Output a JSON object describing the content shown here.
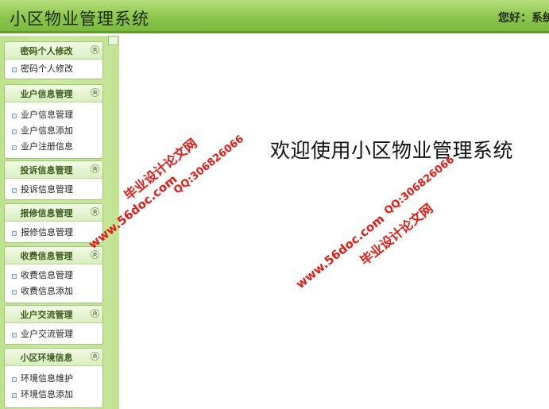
{
  "header": {
    "title": "小区物业管理系统",
    "greeting_prefix": "您好：",
    "greeting_user": "系统"
  },
  "sidebar": {
    "groups": [
      {
        "title": "密码个人修改",
        "items": [
          "密码个人修改"
        ]
      },
      {
        "title": "业户信息管理",
        "items": [
          "业户信息管理",
          "业户信息添加",
          "业户注册信息"
        ]
      },
      {
        "title": "投诉信息管理",
        "items": [
          "投诉信息管理"
        ]
      },
      {
        "title": "报修信息管理",
        "items": [
          "报修信息管理"
        ]
      },
      {
        "title": "收费信息管理",
        "items": [
          "收费信息管理",
          "收费信息添加"
        ]
      },
      {
        "title": "业户交流管理",
        "items": [
          "业户交流管理"
        ]
      },
      {
        "title": "小区环境信息",
        "items": [
          "环境信息维护",
          "环境信息添加"
        ]
      }
    ]
  },
  "main": {
    "welcome": "欢迎使用小区物业管理系统"
  },
  "watermarks": {
    "site": "www.56doc.com",
    "brand": "毕业设计论文网",
    "qq": "QQ:306826066"
  },
  "colors": {
    "header_green": "#8cc64d",
    "sidebar_green": "#c2e493",
    "watermark_red": "#e41b14"
  }
}
